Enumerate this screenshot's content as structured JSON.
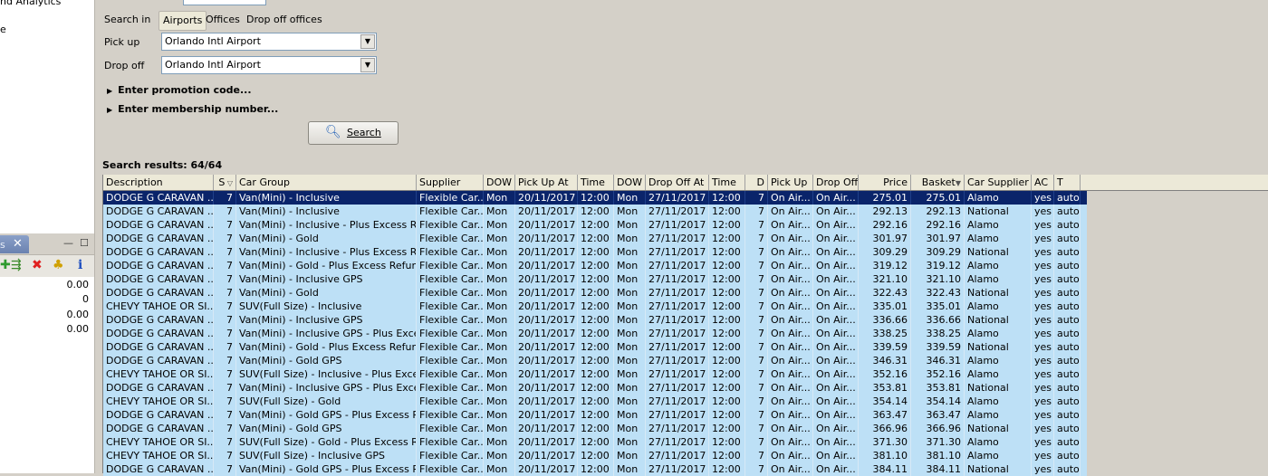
{
  "left_panel": {
    "tree_items": [
      "nd Analytics",
      "e"
    ],
    "tab_label": "s",
    "window_controls": [
      "—",
      "☐"
    ],
    "toolbar_icons": [
      "add-green-icon",
      "export-icon",
      "delete-icon",
      "palm-icon",
      "info-icon"
    ],
    "values": [
      "0.00",
      "0",
      "0.00",
      "0.00"
    ]
  },
  "form": {
    "search_in_label": "Search in",
    "segments": [
      "Airports",
      "Offices",
      "Drop off offices"
    ],
    "pickup_label": "Pick up",
    "pickup_value": "Orlando Intl Airport",
    "dropoff_label": "Drop off",
    "dropoff_value": "Orlando Intl Airport",
    "promo_label": "Enter promotion code...",
    "membership_label": "Enter membership number...",
    "search_button": "Search",
    "results_label": "Search results: 64/64"
  },
  "grid": {
    "columns": [
      "Description",
      "S",
      "Car Group",
      "Supplier",
      "DOW",
      "Pick Up At",
      "Time",
      "DOW",
      "Drop Off At",
      "Time",
      "D",
      "Pick Up",
      "Drop Off",
      "Price",
      "Basket",
      "Car Supplier",
      "AC",
      "T"
    ],
    "rows": [
      [
        "DODGE G CARAVAN ...",
        "7",
        "Van(Mini) - Inclusive",
        "Flexible Car...",
        "Mon",
        "20/11/2017",
        "12:00",
        "Mon",
        "27/11/2017",
        "12:00",
        "7",
        "On Air...",
        "On Air...",
        "275.01",
        "275.01",
        "Alamo",
        "yes",
        "auto"
      ],
      [
        "DODGE G CARAVAN ...",
        "7",
        "Van(Mini) - Inclusive",
        "Flexible Car...",
        "Mon",
        "20/11/2017",
        "12:00",
        "Mon",
        "27/11/2017",
        "12:00",
        "7",
        "On Air...",
        "On Air...",
        "292.13",
        "292.13",
        "National",
        "yes",
        "auto"
      ],
      [
        "DODGE G CARAVAN ...",
        "7",
        "Van(Mini) - Inclusive - Plus Excess Ref...",
        "Flexible Car...",
        "Mon",
        "20/11/2017",
        "12:00",
        "Mon",
        "27/11/2017",
        "12:00",
        "7",
        "On Air...",
        "On Air...",
        "292.16",
        "292.16",
        "Alamo",
        "yes",
        "auto"
      ],
      [
        "DODGE G CARAVAN ...",
        "7",
        "Van(Mini) - Gold",
        "Flexible Car...",
        "Mon",
        "20/11/2017",
        "12:00",
        "Mon",
        "27/11/2017",
        "12:00",
        "7",
        "On Air...",
        "On Air...",
        "301.97",
        "301.97",
        "Alamo",
        "yes",
        "auto"
      ],
      [
        "DODGE G CARAVAN ...",
        "7",
        "Van(Mini) - Inclusive - Plus Excess Ref...",
        "Flexible Car...",
        "Mon",
        "20/11/2017",
        "12:00",
        "Mon",
        "27/11/2017",
        "12:00",
        "7",
        "On Air...",
        "On Air...",
        "309.29",
        "309.29",
        "National",
        "yes",
        "auto"
      ],
      [
        "DODGE G CARAVAN ...",
        "7",
        "Van(Mini) - Gold - Plus Excess Refund",
        "Flexible Car...",
        "Mon",
        "20/11/2017",
        "12:00",
        "Mon",
        "27/11/2017",
        "12:00",
        "7",
        "On Air...",
        "On Air...",
        "319.12",
        "319.12",
        "Alamo",
        "yes",
        "auto"
      ],
      [
        "DODGE G CARAVAN ...",
        "7",
        "Van(Mini) - Inclusive GPS",
        "Flexible Car...",
        "Mon",
        "20/11/2017",
        "12:00",
        "Mon",
        "27/11/2017",
        "12:00",
        "7",
        "On Air...",
        "On Air...",
        "321.10",
        "321.10",
        "Alamo",
        "yes",
        "auto"
      ],
      [
        "DODGE G CARAVAN ...",
        "7",
        "Van(Mini) - Gold",
        "Flexible Car...",
        "Mon",
        "20/11/2017",
        "12:00",
        "Mon",
        "27/11/2017",
        "12:00",
        "7",
        "On Air...",
        "On Air...",
        "322.43",
        "322.43",
        "National",
        "yes",
        "auto"
      ],
      [
        "CHEVY TAHOE OR SI...",
        "7",
        "SUV(Full Size) - Inclusive",
        "Flexible Car...",
        "Mon",
        "20/11/2017",
        "12:00",
        "Mon",
        "27/11/2017",
        "12:00",
        "7",
        "On Air...",
        "On Air...",
        "335.01",
        "335.01",
        "Alamo",
        "yes",
        "auto"
      ],
      [
        "DODGE G CARAVAN ...",
        "7",
        "Van(Mini) - Inclusive GPS",
        "Flexible Car...",
        "Mon",
        "20/11/2017",
        "12:00",
        "Mon",
        "27/11/2017",
        "12:00",
        "7",
        "On Air...",
        "On Air...",
        "336.66",
        "336.66",
        "National",
        "yes",
        "auto"
      ],
      [
        "DODGE G CARAVAN ...",
        "7",
        "Van(Mini) - Inclusive GPS - Plus Exces...",
        "Flexible Car...",
        "Mon",
        "20/11/2017",
        "12:00",
        "Mon",
        "27/11/2017",
        "12:00",
        "7",
        "On Air...",
        "On Air...",
        "338.25",
        "338.25",
        "Alamo",
        "yes",
        "auto"
      ],
      [
        "DODGE G CARAVAN ...",
        "7",
        "Van(Mini) - Gold - Plus Excess Refund",
        "Flexible Car...",
        "Mon",
        "20/11/2017",
        "12:00",
        "Mon",
        "27/11/2017",
        "12:00",
        "7",
        "On Air...",
        "On Air...",
        "339.59",
        "339.59",
        "National",
        "yes",
        "auto"
      ],
      [
        "DODGE G CARAVAN ...",
        "7",
        "Van(Mini) - Gold GPS",
        "Flexible Car...",
        "Mon",
        "20/11/2017",
        "12:00",
        "Mon",
        "27/11/2017",
        "12:00",
        "7",
        "On Air...",
        "On Air...",
        "346.31",
        "346.31",
        "Alamo",
        "yes",
        "auto"
      ],
      [
        "CHEVY TAHOE OR SI...",
        "7",
        "SUV(Full Size) - Inclusive - Plus Excess...",
        "Flexible Car...",
        "Mon",
        "20/11/2017",
        "12:00",
        "Mon",
        "27/11/2017",
        "12:00",
        "7",
        "On Air...",
        "On Air...",
        "352.16",
        "352.16",
        "Alamo",
        "yes",
        "auto"
      ],
      [
        "DODGE G CARAVAN ...",
        "7",
        "Van(Mini) - Inclusive GPS - Plus Exces...",
        "Flexible Car...",
        "Mon",
        "20/11/2017",
        "12:00",
        "Mon",
        "27/11/2017",
        "12:00",
        "7",
        "On Air...",
        "On Air...",
        "353.81",
        "353.81",
        "National",
        "yes",
        "auto"
      ],
      [
        "CHEVY TAHOE OR SI...",
        "7",
        "SUV(Full Size) - Gold",
        "Flexible Car...",
        "Mon",
        "20/11/2017",
        "12:00",
        "Mon",
        "27/11/2017",
        "12:00",
        "7",
        "On Air...",
        "On Air...",
        "354.14",
        "354.14",
        "Alamo",
        "yes",
        "auto"
      ],
      [
        "DODGE G CARAVAN ...",
        "7",
        "Van(Mini) - Gold GPS - Plus Excess Ref...",
        "Flexible Car...",
        "Mon",
        "20/11/2017",
        "12:00",
        "Mon",
        "27/11/2017",
        "12:00",
        "7",
        "On Air...",
        "On Air...",
        "363.47",
        "363.47",
        "Alamo",
        "yes",
        "auto"
      ],
      [
        "DODGE G CARAVAN ...",
        "7",
        "Van(Mini) - Gold GPS",
        "Flexible Car...",
        "Mon",
        "20/11/2017",
        "12:00",
        "Mon",
        "27/11/2017",
        "12:00",
        "7",
        "On Air...",
        "On Air...",
        "366.96",
        "366.96",
        "National",
        "yes",
        "auto"
      ],
      [
        "CHEVY TAHOE OR SI...",
        "7",
        "SUV(Full Size) - Gold - Plus Excess Ref...",
        "Flexible Car...",
        "Mon",
        "20/11/2017",
        "12:00",
        "Mon",
        "27/11/2017",
        "12:00",
        "7",
        "On Air...",
        "On Air...",
        "371.30",
        "371.30",
        "Alamo",
        "yes",
        "auto"
      ],
      [
        "CHEVY TAHOE OR SI...",
        "7",
        "SUV(Full Size) - Inclusive GPS",
        "Flexible Car...",
        "Mon",
        "20/11/2017",
        "12:00",
        "Mon",
        "27/11/2017",
        "12:00",
        "7",
        "On Air...",
        "On Air...",
        "381.10",
        "381.10",
        "Alamo",
        "yes",
        "auto"
      ],
      [
        "DODGE G CARAVAN ...",
        "7",
        "Van(Mini) - Gold GPS - Plus Excess Ref...",
        "Flexible Car...",
        "Mon",
        "20/11/2017",
        "12:00",
        "Mon",
        "27/11/2017",
        "12:00",
        "7",
        "On Air...",
        "On Air...",
        "384.11",
        "384.11",
        "National",
        "yes",
        "auto"
      ]
    ]
  },
  "colors": {
    "row_bg": "#bde0f6",
    "selected_bg": "#0a246a",
    "window_bg": "#d4d0c8"
  }
}
